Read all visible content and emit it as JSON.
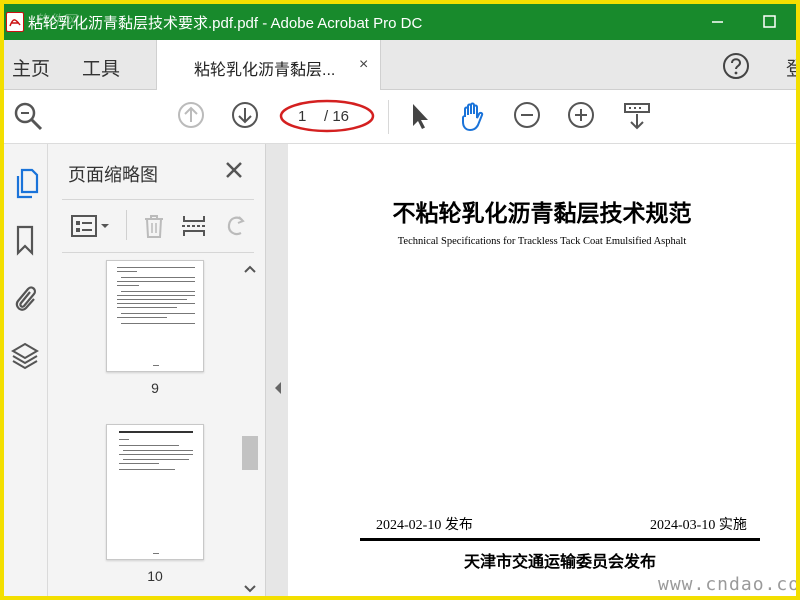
{
  "window": {
    "title": "粘轮乳化沥青黏层技术要求.pdf.pdf - Adobe Acrobat Pro DC",
    "watermark": "软件网"
  },
  "tabbar": {
    "home": "主页",
    "tools": "工具",
    "doc_tab": "粘轮乳化沥青黏层...",
    "doc_tab_close": "×",
    "signin": "登"
  },
  "toolbar": {
    "current_page": "1",
    "total_pages": "/ 16"
  },
  "thumbnails_panel": {
    "title": "页面缩略图",
    "pages": [
      {
        "label": "9"
      },
      {
        "label": "10"
      }
    ]
  },
  "document": {
    "title": "不粘轮乳化沥青黏层技术规范",
    "subtitle": "Technical Specifications for Trackless Tack Coat Emulsified Asphalt",
    "issue_date": "2024-02-10 发布",
    "implement_date": "2024-03-10 实施",
    "publisher": "天津市交通运输委员会发布"
  },
  "site_watermark": "www.cndao.com",
  "colors": {
    "titlebar": "#188a2c",
    "border": "#f3df00",
    "accent_blue": "#1a73d9",
    "annotation_red": "#d42020"
  }
}
